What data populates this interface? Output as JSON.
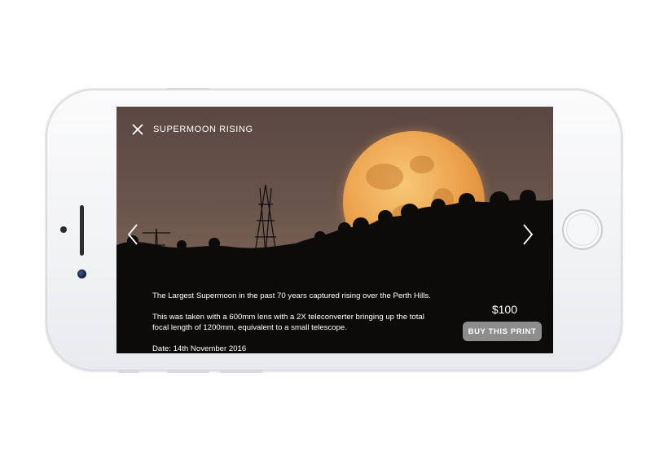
{
  "viewer": {
    "title": "SUPERMOON RISING",
    "description": [
      "The Largest Supermoon in the past 70 years captured rising over the Perth Hills.",
      "This was taken with a 600mm lens with a 2X teleconverter bringing up the total focal length of 1200mm, equivalent to a small telescope."
    ],
    "date": "Date: 14th November 2016",
    "price": "$100",
    "buy_label": "BUY THIS PRINT"
  },
  "icons": {
    "close": "close-icon",
    "prev": "chevron-left-icon",
    "next": "chevron-right-icon"
  },
  "colors": {
    "button_bg": "#8d8d8d",
    "text": "#ffffff",
    "moon": "#eea550"
  }
}
